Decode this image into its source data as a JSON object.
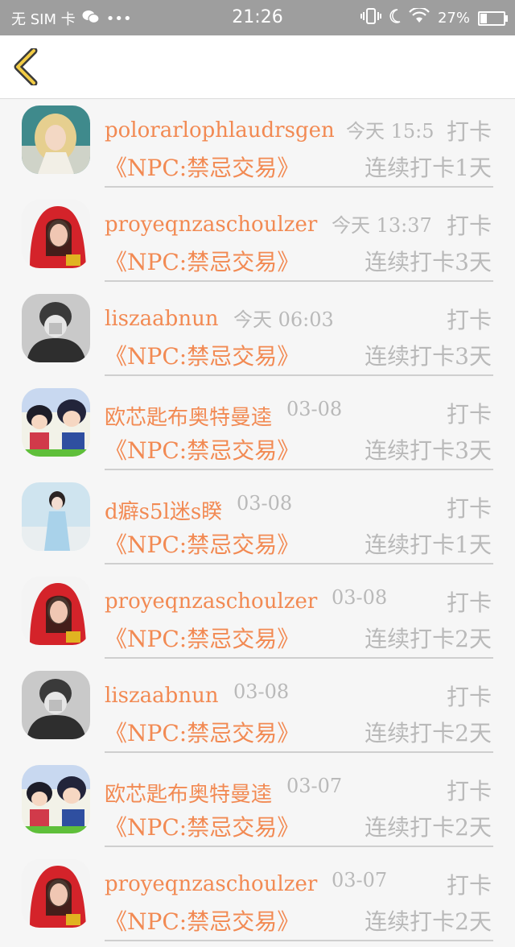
{
  "status_bar": {
    "carrier": "无 SIM 卡",
    "time": "21:26",
    "battery": "27%",
    "battery_level": 0.27
  },
  "nav": {
    "back_icon": "chevron-left-icon"
  },
  "checkins": [
    {
      "name": "polorarlophlaudrsgen",
      "time": "今天 15:5",
      "action": "打卡",
      "group": "《NPC:禁忌交易》",
      "streak": "连续打卡1天",
      "avatar": "blonde-girl"
    },
    {
      "name": "proyeqnzaschoulzer",
      "time": "今天 13:37",
      "action": "打卡",
      "group": "《NPC:禁忌交易》",
      "streak": "连续打卡3天",
      "avatar": "red-hood"
    },
    {
      "name": "liszaabnun",
      "time": "今天 06:03",
      "action": "打卡",
      "group": "《NPC:禁忌交易》",
      "streak": "连续打卡3天",
      "avatar": "grayscale-boy"
    },
    {
      "name": "欧芯匙布奥特曼逵",
      "time": "03-08",
      "action": "打卡",
      "group": "《NPC:禁忌交易》",
      "streak": "连续打卡3天",
      "avatar": "anime"
    },
    {
      "name": "d癖s5l迷s睽",
      "time": "03-08",
      "action": "打卡",
      "group": "《NPC:禁忌交易》",
      "streak": "连续打卡1天",
      "avatar": "blue-girl"
    },
    {
      "name": "proyeqnzaschoulzer",
      "time": "03-08",
      "action": "打卡",
      "group": "《NPC:禁忌交易》",
      "streak": "连续打卡2天",
      "avatar": "red-hood"
    },
    {
      "name": "liszaabnun",
      "time": "03-08",
      "action": "打卡",
      "group": "《NPC:禁忌交易》",
      "streak": "连续打卡2天",
      "avatar": "grayscale-boy"
    },
    {
      "name": "欧芯匙布奥特曼逵",
      "time": "03-07",
      "action": "打卡",
      "group": "《NPC:禁忌交易》",
      "streak": "连续打卡2天",
      "avatar": "anime"
    },
    {
      "name": "proyeqnzaschoulzer",
      "time": "03-07",
      "action": "打卡",
      "group": "《NPC:禁忌交易》",
      "streak": "连续打卡2天",
      "avatar": "red-hood"
    }
  ]
}
